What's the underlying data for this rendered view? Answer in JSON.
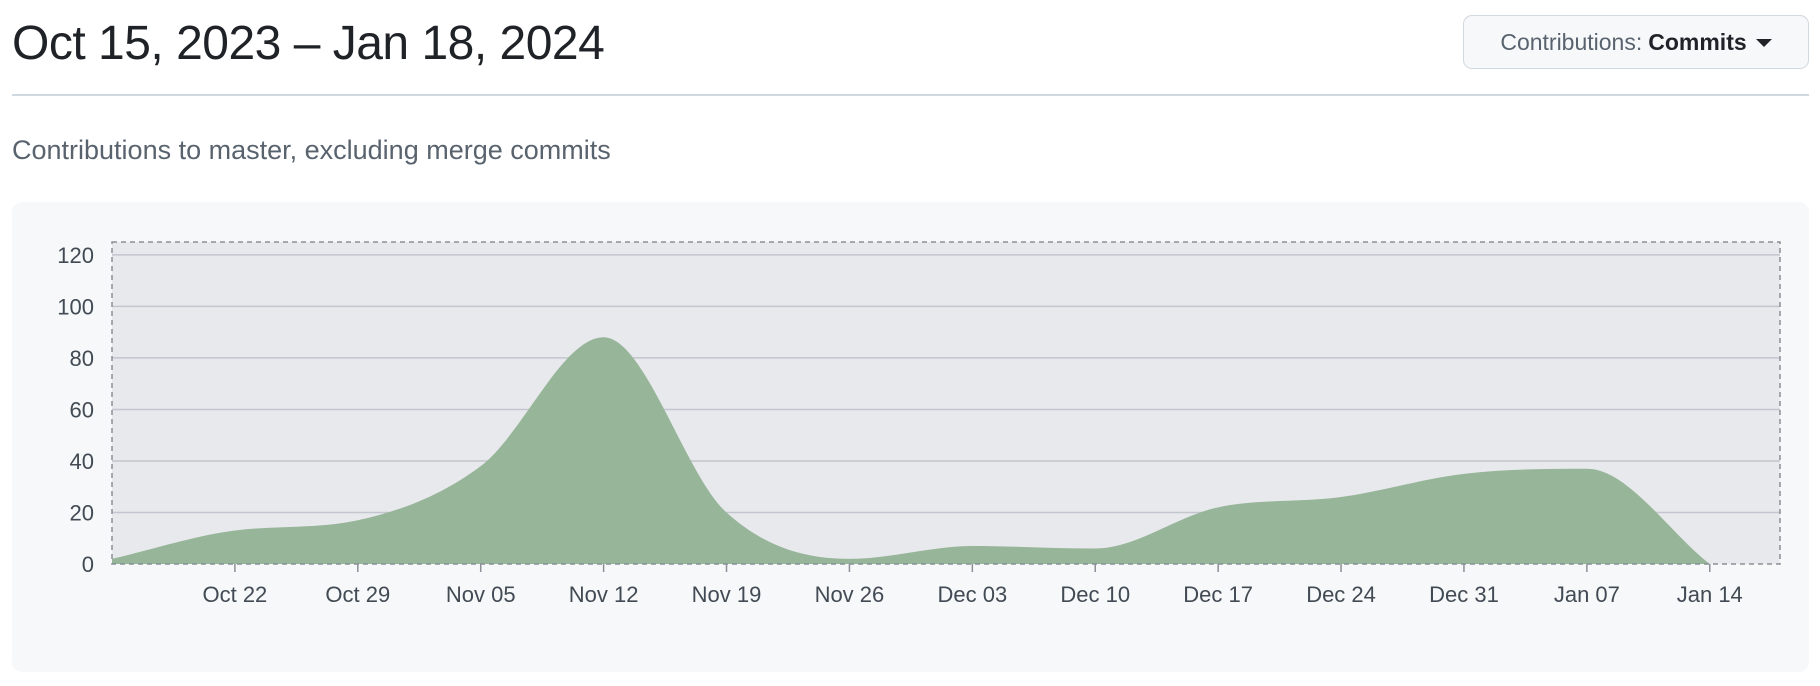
{
  "header": {
    "date_range": "Oct 15, 2023 – Jan 18, 2024",
    "dropdown_label": "Contributions:",
    "dropdown_value": "Commits"
  },
  "subtitle": "Contributions to master, excluding merge commits",
  "colors": {
    "area_fill": "#97b599",
    "plot_background": "#e8e9ed",
    "panel_background": "#f6f8fa",
    "gridline": "#c3c6cf",
    "tick_text": "#424a53"
  },
  "chart_data": {
    "type": "area",
    "title": "",
    "xlabel": "",
    "ylabel": "",
    "ylim": [
      0,
      125
    ],
    "yticks": [
      0,
      20,
      40,
      60,
      80,
      100,
      120
    ],
    "xlim": [
      "2023-10-15",
      "2024-01-18"
    ],
    "xticks": [
      "Oct 22",
      "Oct 29",
      "Nov 05",
      "Nov 12",
      "Nov 19",
      "Nov 26",
      "Dec 03",
      "Dec 10",
      "Dec 17",
      "Dec 24",
      "Dec 31",
      "Jan 07",
      "Jan 14"
    ],
    "grid": true,
    "series": [
      {
        "x": [
          "2023-10-15",
          "2023-10-22",
          "2023-10-29",
          "2023-11-05",
          "2023-11-12",
          "2023-11-19",
          "2023-11-26",
          "2023-12-03",
          "2023-12-10",
          "2023-12-17",
          "2023-12-24",
          "2023-12-31",
          "2024-01-07",
          "2024-01-14"
        ],
        "values": [
          2,
          13,
          17,
          38,
          88,
          20,
          2,
          7,
          6,
          22,
          26,
          35,
          37,
          0
        ]
      }
    ]
  }
}
